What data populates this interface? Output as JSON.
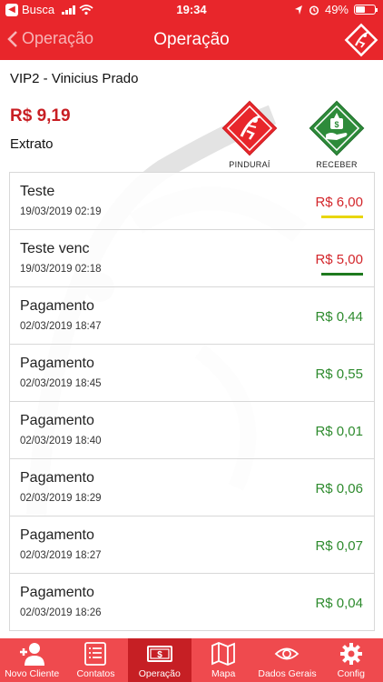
{
  "status": {
    "back_app": "Busca",
    "time": "19:34",
    "battery": "49%"
  },
  "nav": {
    "back_label": "Operação",
    "title": "Operação"
  },
  "account": {
    "name": "VIP2 - Vinicius Prado",
    "balance": "R$ 9,19",
    "section_label": "Extrato"
  },
  "actions": [
    {
      "label": "PINDURAÍ",
      "icon": "hanging-man-icon",
      "color": "#e8262b"
    },
    {
      "label": "RECEBER",
      "icon": "money-hand-icon",
      "color": "#2e8b3a"
    }
  ],
  "transactions": [
    {
      "description": "Teste",
      "date": "19/03/2019 02:19",
      "amount": "R$ 6,00",
      "type": "neg",
      "underline": "#e8d60f"
    },
    {
      "description": "Teste venc",
      "date": "19/03/2019 02:18",
      "amount": "R$ 5,00",
      "type": "neg",
      "underline": "#1e7a1e"
    },
    {
      "description": "Pagamento",
      "date": "02/03/2019 18:47",
      "amount": "R$ 0,44",
      "type": "pos"
    },
    {
      "description": "Pagamento",
      "date": "02/03/2019 18:45",
      "amount": "R$ 0,55",
      "type": "pos"
    },
    {
      "description": "Pagamento",
      "date": "02/03/2019 18:40",
      "amount": "R$ 0,01",
      "type": "pos"
    },
    {
      "description": "Pagamento",
      "date": "02/03/2019 18:29",
      "amount": "R$ 0,06",
      "type": "pos"
    },
    {
      "description": "Pagamento",
      "date": "02/03/2019 18:27",
      "amount": "R$ 0,07",
      "type": "pos"
    },
    {
      "description": "Pagamento",
      "date": "02/03/2019 18:26",
      "amount": "R$ 0,04",
      "type": "pos"
    }
  ],
  "tabs": [
    {
      "label": "Novo Cliente",
      "icon": "add-user-icon",
      "active": false
    },
    {
      "label": "Contatos",
      "icon": "contacts-list-icon",
      "active": false
    },
    {
      "label": "Operação",
      "icon": "cash-icon",
      "active": true
    },
    {
      "label": "Mapa",
      "icon": "map-icon",
      "active": false
    },
    {
      "label": "Dados Gerais",
      "icon": "eye-icon",
      "active": false
    },
    {
      "label": "Config",
      "icon": "gear-icon",
      "active": false
    }
  ],
  "colors": {
    "brand": "#e8262b",
    "tab_bar": "#ef4a4e",
    "tab_active": "#c61f24",
    "negative": "#d3262b",
    "positive": "#2e8b2e"
  }
}
